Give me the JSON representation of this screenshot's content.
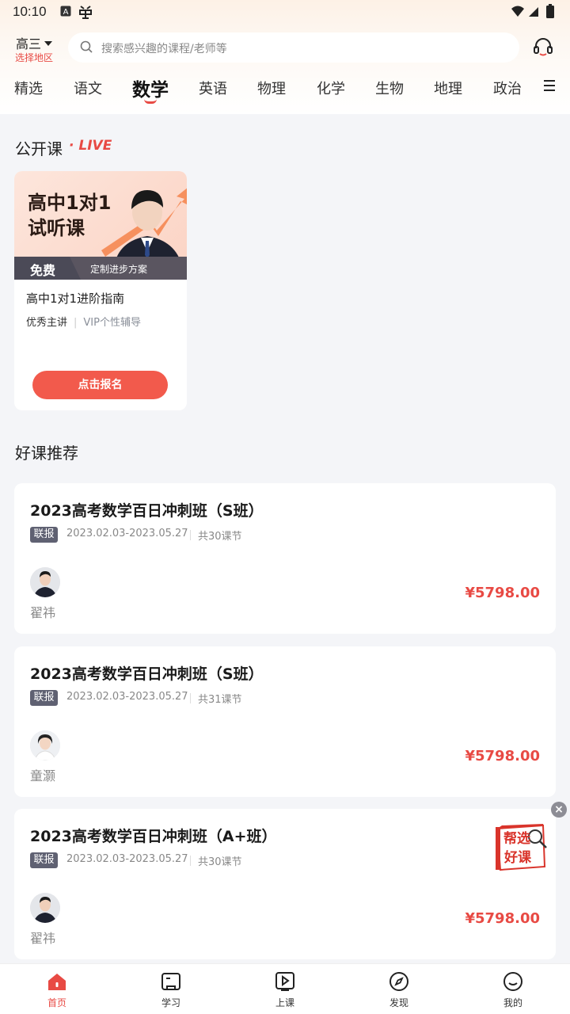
{
  "status_bar": {
    "time": "10:10"
  },
  "header": {
    "grade": "高三",
    "region": "选择地区",
    "search_placeholder": "搜索感兴趣的课程/老师等"
  },
  "subjects": [
    "精选",
    "语文",
    "数学",
    "英语",
    "物理",
    "化学",
    "生物",
    "地理",
    "政治"
  ],
  "active_subject": "数学",
  "open_class": {
    "title": "公开课",
    "live_label": "· LIVE",
    "card": {
      "banner_title_line1": "高中1对1",
      "banner_title_line2": "试听课",
      "free_badge": "免费",
      "plan_text": "定制进步方案",
      "title": "高中1对1进阶指南",
      "meta_left": "优秀主讲",
      "meta_right": "VIP个性辅导",
      "button": "点击报名"
    }
  },
  "recommend": {
    "title": "好课推荐",
    "courses": [
      {
        "title": "2023高考数学百日冲刺班（S班）",
        "tag": "联报",
        "dates": "2023.02.03-2023.05.27",
        "lessons": "共30课节",
        "teacher": "翟祎",
        "price": "¥5798.00"
      },
      {
        "title": "2023高考数学百日冲刺班（S班）",
        "tag": "联报",
        "dates": "2023.02.03-2023.05.27",
        "lessons": "共31课节",
        "teacher": "童灏",
        "price": "¥5798.00"
      },
      {
        "title": "2023高考数学百日冲刺班（A+班）",
        "tag": "联报",
        "dates": "2023.02.03-2023.05.27",
        "lessons": "共30课节",
        "teacher": "翟祎",
        "price": "¥5798.00"
      }
    ]
  },
  "promo": {
    "line1": "帮选",
    "line2": "好课"
  },
  "tabbar": [
    {
      "label": "首页",
      "icon": "home-icon"
    },
    {
      "label": "学习",
      "icon": "book-icon"
    },
    {
      "label": "上课",
      "icon": "play-icon"
    },
    {
      "label": "发现",
      "icon": "compass-icon"
    },
    {
      "label": "我的",
      "icon": "profile-icon"
    }
  ],
  "colors": {
    "accent": "#e84a44",
    "tag_bg": "#5f6172"
  }
}
